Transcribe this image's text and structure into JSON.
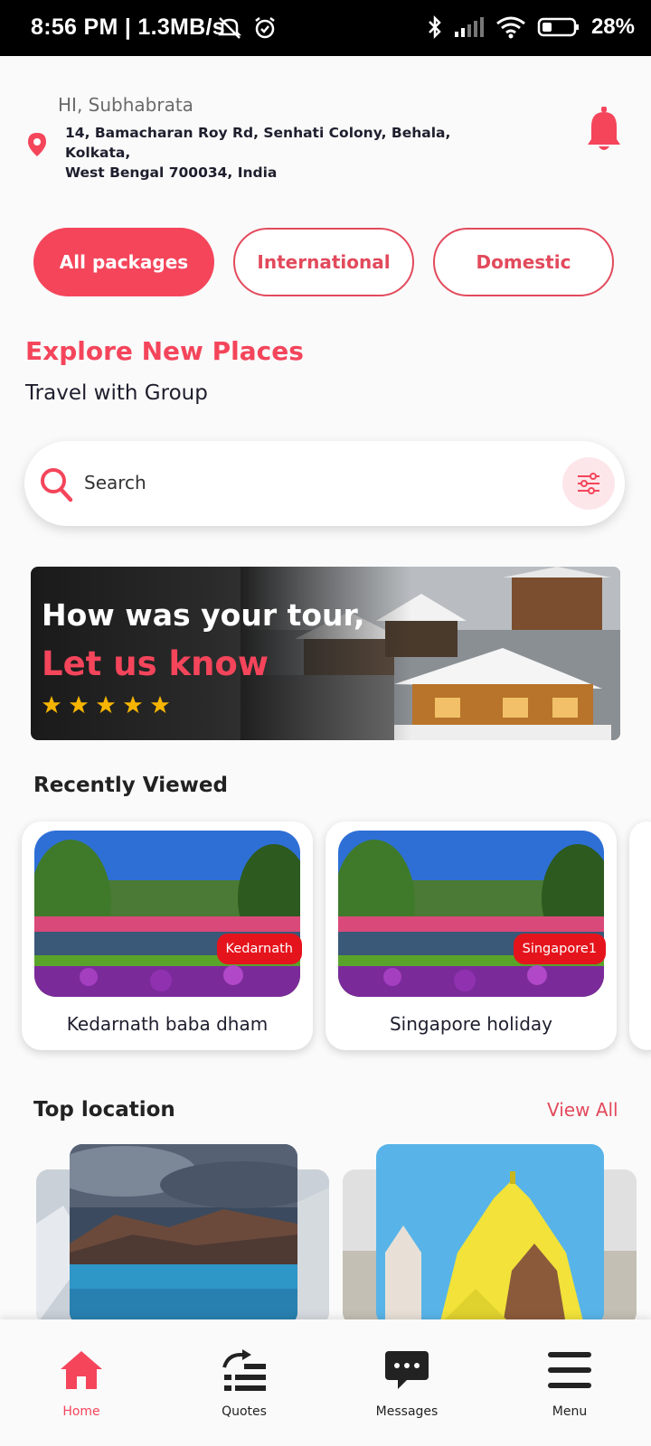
{
  "status_bar": {
    "time": "8:56 PM | 1.3MB/s",
    "battery": "28%"
  },
  "header": {
    "greeting": "HI, Subhabrata",
    "address_line1": "14, Bamacharan Roy Rd, Senhati Colony, Behala, Kolkata,",
    "address_line2": "West Bengal 700034, India"
  },
  "tabs": [
    {
      "label": "All  packages",
      "active": true
    },
    {
      "label": "International",
      "active": false
    },
    {
      "label": "Domestic",
      "active": false
    }
  ],
  "intro": {
    "title": "Explore New Places",
    "subtitle": "Travel with Group"
  },
  "search": {
    "placeholder": "Search"
  },
  "banner": {
    "line1": "How was your tour,",
    "line2": "Let us know",
    "rating_stars": 5
  },
  "recently_viewed": {
    "title": "Recently Viewed",
    "items": [
      {
        "tag": "Kedarnath",
        "name": "Kedarnath baba dham"
      },
      {
        "tag": "Singapore1",
        "name": "Singapore holiday"
      }
    ]
  },
  "top_location": {
    "title": "Top location",
    "view_all": "View All"
  },
  "bottom_nav": [
    {
      "label": "Home",
      "icon": "home-icon",
      "active": true
    },
    {
      "label": "Quotes",
      "icon": "quotes-icon",
      "active": false
    },
    {
      "label": "Messages",
      "icon": "messages-icon",
      "active": false
    },
    {
      "label": "Menu",
      "icon": "menu-icon",
      "active": false
    }
  ],
  "colors": {
    "accent": "#f4455b",
    "tag_red": "#e5141c",
    "star": "#f7b500"
  }
}
